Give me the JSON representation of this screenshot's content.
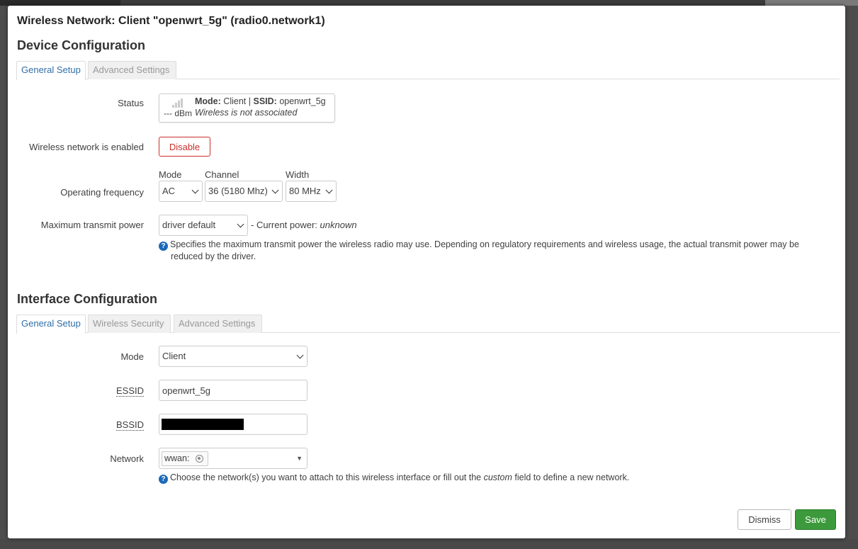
{
  "modal": {
    "title": "Wireless Network: Client \"openwrt_5g\" (radio0.network1)"
  },
  "device": {
    "title": "Device Configuration",
    "tabs": [
      "General Setup",
      "Advanced Settings"
    ],
    "status": {
      "label": "Status",
      "dbm": "--- dBm",
      "mode_label": "Mode:",
      "mode_value": "Client",
      "sep": "|",
      "ssid_label": "SSID:",
      "ssid_value": "openwrt_5g",
      "assoc": "Wireless is not associated"
    },
    "enabled": {
      "label": "Wireless network is enabled",
      "button": "Disable"
    },
    "freq": {
      "label": "Operating frequency",
      "mode_label": "Mode",
      "mode_value": "AC",
      "channel_label": "Channel",
      "channel_value": "36 (5180 Mhz)",
      "width_label": "Width",
      "width_value": "80 MHz"
    },
    "txpower": {
      "label": "Maximum transmit power",
      "value": "driver default",
      "current_prefix": "- Current power:",
      "current_value": "unknown",
      "help_line1": "Specifies the maximum transmit power the wireless radio may use. Depending on regulatory requirements and wireless usage, the actual transmit power may be",
      "help_line2": "reduced by the driver."
    }
  },
  "iface": {
    "title": "Interface Configuration",
    "tabs": [
      "General Setup",
      "Wireless Security",
      "Advanced Settings"
    ],
    "mode": {
      "label": "Mode",
      "value": "Client"
    },
    "essid": {
      "label": "ESSID",
      "value": "openwrt_5g"
    },
    "bssid": {
      "label": "BSSID"
    },
    "network": {
      "label": "Network",
      "chip": "wwan:",
      "help_prefix": "Choose the network(s) you want to attach to this wireless interface or fill out the",
      "help_em": "custom",
      "help_suffix": "field to define a new network."
    }
  },
  "footer": {
    "dismiss": "Dismiss",
    "save": "Save"
  },
  "colors": {
    "accent": "#2f6ea8",
    "danger": "#c9302c",
    "save": "#3c9a3c"
  }
}
